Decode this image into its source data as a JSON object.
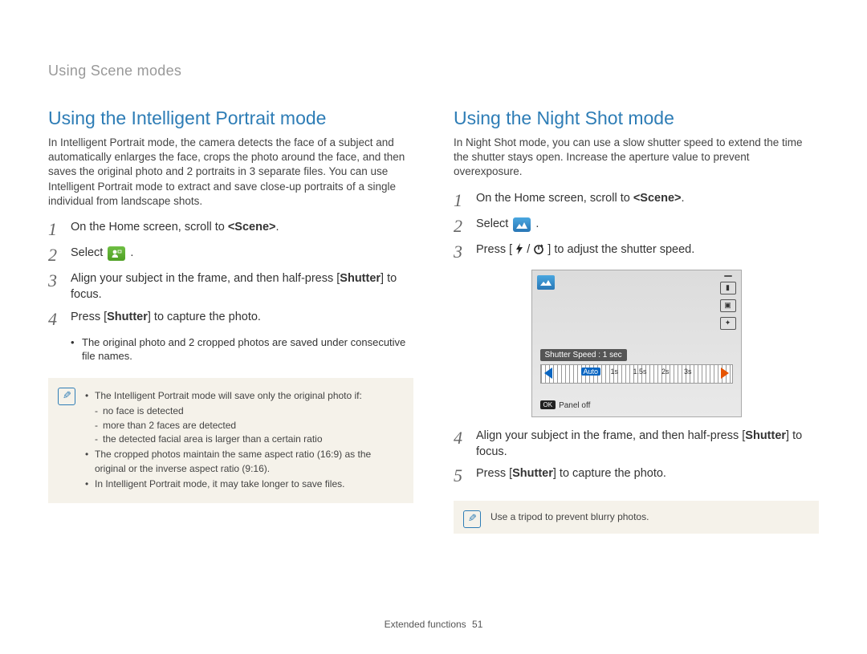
{
  "section_header": "Using Scene modes",
  "left": {
    "heading": "Using the Intelligent Portrait mode",
    "intro": "In Intelligent Portrait mode, the camera detects the face of a subject and automatically enlarges the face, crops the photo around the face, and then saves the original photo and 2 portraits in 3 separate files. You can use Intelligent Portrait mode to extract and save close-up portraits of a single individual from landscape shots.",
    "steps": {
      "1": {
        "pre": "On the Home screen, scroll to ",
        "bold": "<Scene>",
        "post": "."
      },
      "2": {
        "pre": "Select ",
        "icon": "portrait-mode-icon",
        "post": "."
      },
      "3": {
        "pre": "Align your subject in the frame, and then half-press [",
        "bold": "Shutter",
        "post": "] to focus."
      },
      "4": {
        "pre": "Press [",
        "bold": "Shutter",
        "post": "] to capture the photo."
      },
      "4_sub": "The original photo and 2 cropped photos are saved under consecutive file names."
    },
    "note": {
      "b1": "The Intelligent Portrait mode will save only the original photo if:",
      "s1": "no face is detected",
      "s2": "more than 2 faces are detected",
      "s3": "the detected facial area is larger than a certain ratio",
      "b2": "The cropped photos maintain the same aspect ratio (16:9) as the original or the inverse aspect ratio (9:16).",
      "b3": "In Intelligent Portrait mode, it may take longer to save files."
    }
  },
  "right": {
    "heading": "Using the Night Shot mode",
    "intro": "In Night Shot mode, you can use a slow shutter speed to extend the time the shutter stays open. Increase the aperture value to prevent overexposure.",
    "steps": {
      "1": {
        "pre": "On the Home screen, scroll to ",
        "bold": "<Scene>",
        "post": "."
      },
      "2": {
        "pre": "Select ",
        "icon": "night-mode-icon",
        "post": "."
      },
      "3": {
        "pre": "Press [",
        "icon1": "flash-icon",
        "slash": "/",
        "icon2": "timer-icon",
        "post": "] to adjust the shutter speed."
      },
      "4": {
        "pre": "Align your subject in the frame, and then half-press [",
        "bold": "Shutter",
        "post": "] to focus."
      },
      "5": {
        "pre": "Press [",
        "bold": "Shutter",
        "post": "] to capture the photo."
      }
    },
    "screen": {
      "shutter_label": "Shutter Speed : 1 sec",
      "vals": [
        "Auto",
        "1s",
        "1.5s",
        "2s",
        "3s"
      ],
      "panel": "Panel off",
      "ok": "OK"
    },
    "note": "Use a tripod to prevent blurry photos."
  },
  "footer": {
    "section": "Extended functions",
    "page": "51"
  }
}
